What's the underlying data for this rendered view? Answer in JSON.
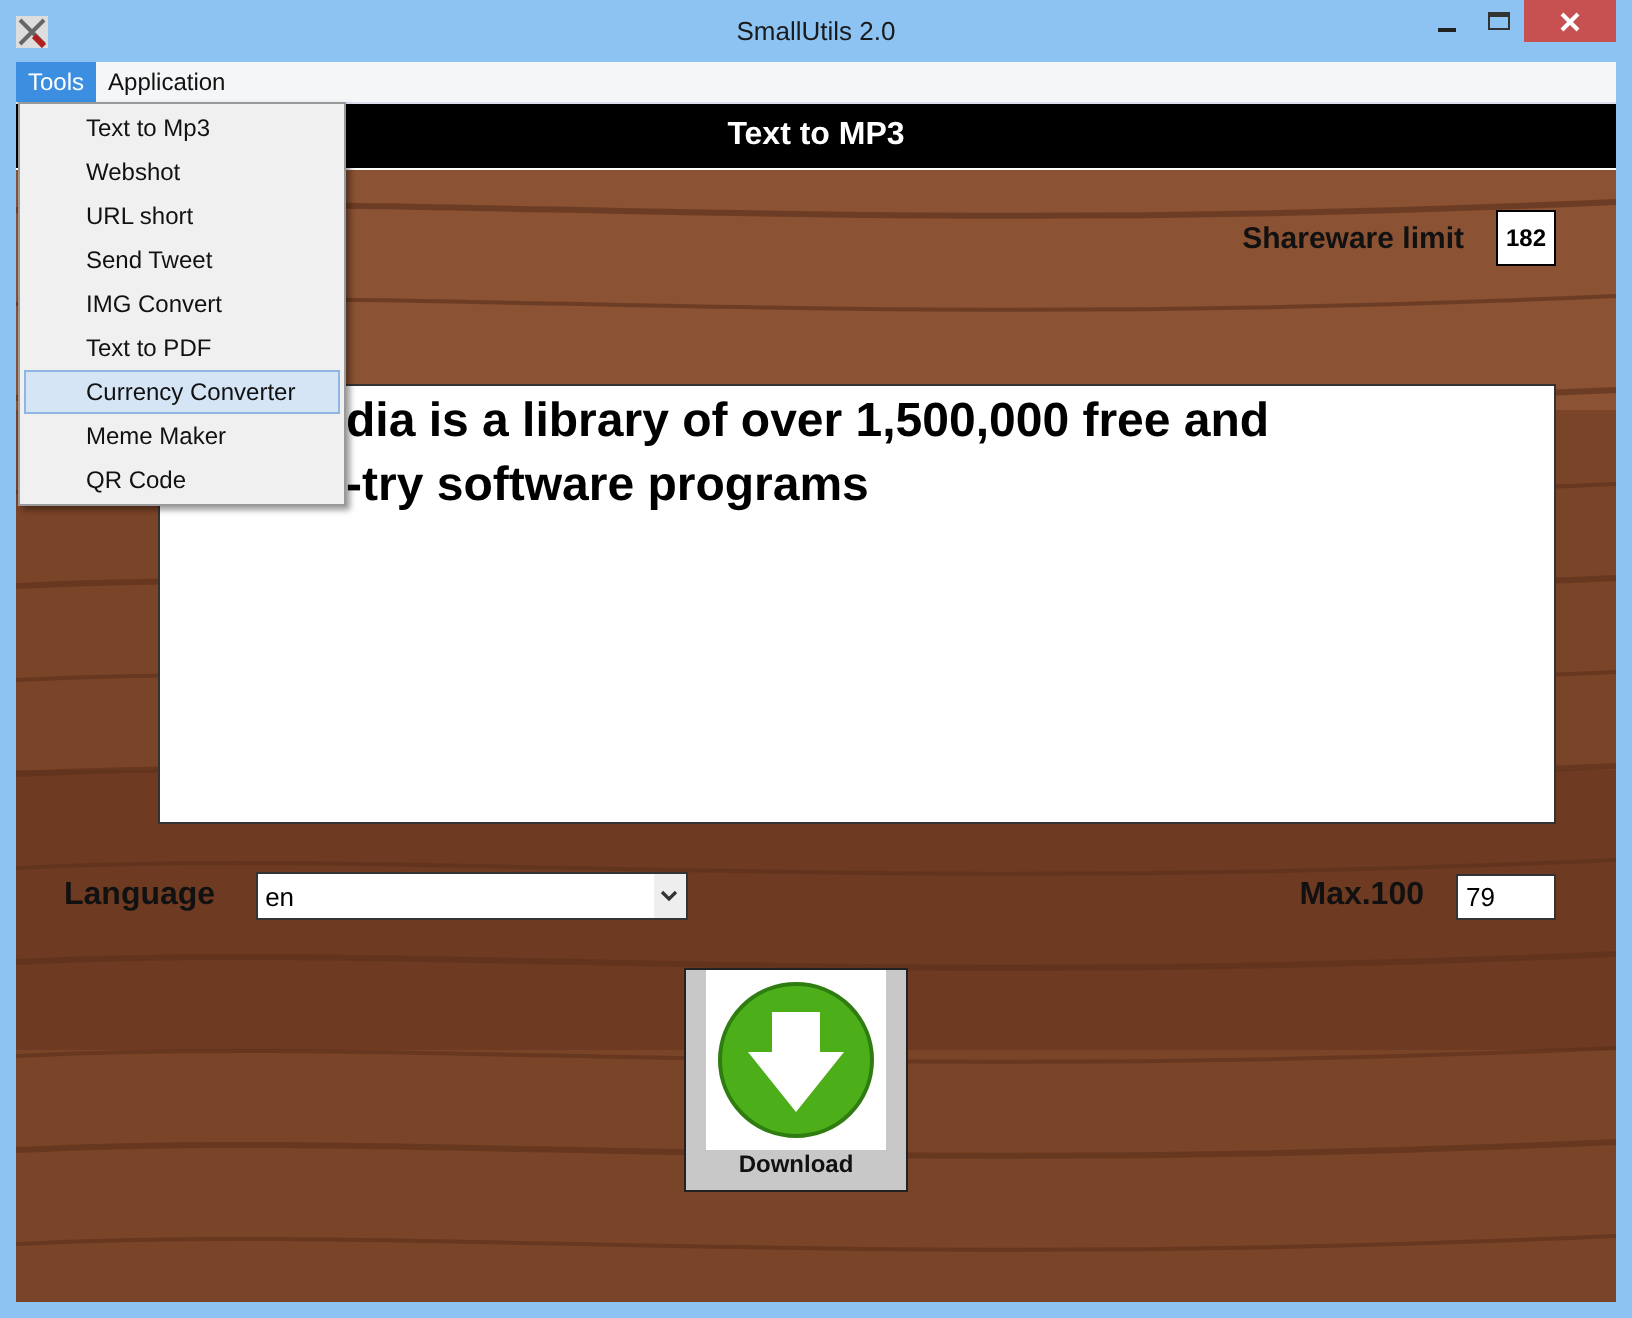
{
  "window": {
    "title": "SmallUtils 2.0"
  },
  "menu_bar": [
    {
      "label": "Tools",
      "selected": true
    },
    {
      "label": "Application",
      "selected": false
    }
  ],
  "menu": {
    "items": [
      {
        "label": "Text to Mp3",
        "selected": false
      },
      {
        "label": "Webshot",
        "selected": false
      },
      {
        "label": "URL short",
        "selected": false
      },
      {
        "label": "Send Tweet",
        "selected": false
      },
      {
        "label": "IMG Convert",
        "selected": false
      },
      {
        "label": "Text to PDF",
        "selected": false
      },
      {
        "label": "Currency Converter",
        "selected": true
      },
      {
        "label": "Meme Maker",
        "selected": false
      },
      {
        "label": "QR Code",
        "selected": false
      }
    ]
  },
  "header": {
    "title": "Text to MP3"
  },
  "shareware": {
    "label": "Shareware limit",
    "value": "182"
  },
  "text_area": {
    "lines": [
      "dia is a library of over 1,500,000 free and",
      "-try software programs"
    ]
  },
  "language": {
    "label": "Language",
    "value": "en"
  },
  "max": {
    "label": "Max.100",
    "value": "79"
  },
  "download_button": {
    "label": "Download"
  }
}
